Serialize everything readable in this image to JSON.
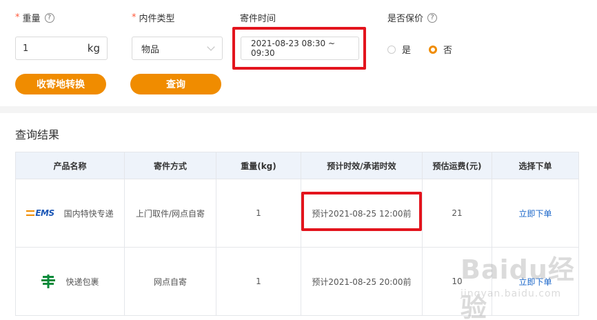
{
  "form": {
    "weight": {
      "label": "重量",
      "required_mark": "*",
      "help": "?",
      "value": "1",
      "unit": "kg"
    },
    "content_type": {
      "label": "内件类型",
      "required_mark": "*",
      "value": "物品"
    },
    "send_time": {
      "label": "寄件时间",
      "value": "2021-08-23 08:30 ~ 09:30"
    },
    "insured": {
      "label": "是否保价",
      "help": "?",
      "options": [
        "是",
        "否"
      ],
      "selected": "否"
    },
    "buttons": {
      "convert": "收寄地转换",
      "query": "查询"
    }
  },
  "results": {
    "title": "查询结果",
    "headers": [
      "产品名称",
      "寄件方式",
      "重量(kg)",
      "预计时效/承诺时效",
      "预估运费(元)",
      "选择下单"
    ],
    "rows": [
      {
        "logo_text": "EMS",
        "logo": "ems-logo",
        "product": "国内特快专递",
        "method": "上门取件/网点自寄",
        "weight": "1",
        "eta": "预计2021-08-25 12:00前",
        "fee": "21",
        "action": "立即下单"
      },
      {
        "logo": "china-post-icon",
        "product": "快递包裹",
        "method": "网点自寄",
        "weight": "1",
        "eta": "预计2021-08-25 20:00前",
        "fee": "10",
        "action": "立即下单"
      }
    ]
  },
  "watermark": {
    "brand": "Baidu经验",
    "url": "jingyan.baidu.com"
  },
  "colors": {
    "accent": "#f08c00",
    "highlight": "#e3141d",
    "link": "#1a66c9",
    "header_bg": "#eef3fa"
  }
}
